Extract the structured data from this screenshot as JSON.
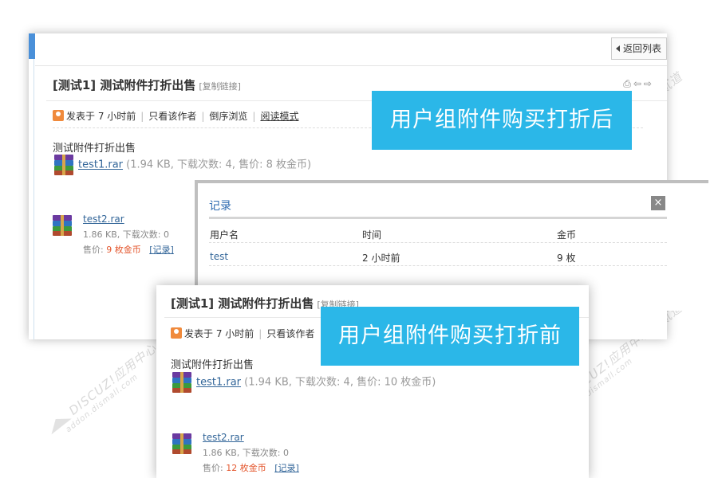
{
  "back_panel": {
    "back_button": "返回列表",
    "title": "[测试1] 测试附件打折出售",
    "copy_link": "[复制链接]",
    "title_icons": "⎙⇦⇨",
    "meta": {
      "posted": "发表于 7 小时前",
      "author_only": "只看该作者",
      "reverse": "倒序浏览",
      "read_mode": "阅读模式"
    },
    "post_text": "测试附件打折出售",
    "attachment1": {
      "name": "test1.rar",
      "info": "(1.94 KB, 下载次数: 4, 售价: 8 枚金币)"
    },
    "attachment2": {
      "name": "test2.rar",
      "size_downloads": "1.86 KB, 下载次数: 0",
      "price_label": "售价:",
      "price_value": "9 枚金币",
      "record_link": "[记录]"
    }
  },
  "record_dialog": {
    "title": "记录",
    "close": "×",
    "headers": [
      "用户名",
      "时间",
      "金币"
    ],
    "rows": [
      {
        "user": "test",
        "time": "2 小时前",
        "coins": "9 枚"
      }
    ]
  },
  "front_panel": {
    "title": "[测试1] 测试附件打折出售",
    "copy_link": "[复制链接]",
    "meta": {
      "posted": "发表于 7 小时前",
      "author_only": "只看该作者"
    },
    "post_text": "测试附件打折出售",
    "attachment1": {
      "name": "test1.rar",
      "info": "(1.94 KB, 下载次数: 4, 售价: 10 枚金币)"
    },
    "attachment2": {
      "name": "test2.rar",
      "size_downloads": "1.86 KB, 下载次数: 0",
      "price_label": "售价:",
      "price_value": "12 枚金币",
      "record_link": "[记录]"
    }
  },
  "banners": {
    "after": "用户组附件购买打折后",
    "before": "用户组附件购买打折前"
  },
  "watermark": {
    "line1": "DISCUZ!应用中心 | 贰道",
    "line2": "addon.dismall.com"
  },
  "colors": {
    "banner": "#2bb7e8",
    "link": "#336699",
    "price": "#e4572e",
    "dialog_title": "#2e6bb0"
  }
}
